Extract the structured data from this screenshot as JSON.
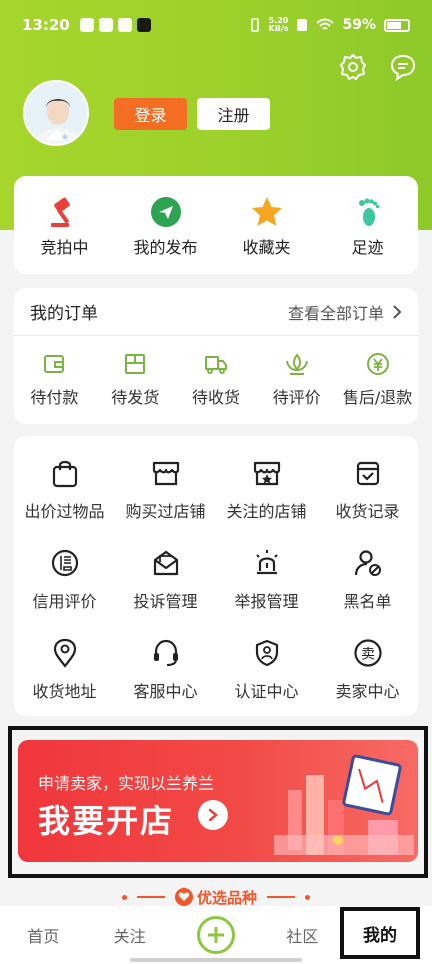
{
  "colors": {
    "top_green": "#9dd12b",
    "accent_orange": "#f36e22",
    "banner_red": "#f0363c",
    "tab_green": "#8dc63f"
  },
  "status_bar": {
    "time": "13:20",
    "net_speed_value": "5.20",
    "net_speed_unit": "KB/s",
    "battery": "59%"
  },
  "header": {
    "settings_icon": "gear-icon",
    "message_icon": "chat-bubble-icon",
    "login_label": "登录",
    "register_label": "注册"
  },
  "quick_actions": [
    {
      "label": "竞拍中",
      "icon": "auction-hammer-icon"
    },
    {
      "label": "我的发布",
      "icon": "paper-plane-icon"
    },
    {
      "label": "收藏夹",
      "icon": "star-icon"
    },
    {
      "label": "足迹",
      "icon": "footprint-icon"
    }
  ],
  "orders": {
    "title": "我的订单",
    "view_all": "查看全部订单",
    "items": [
      {
        "label": "待付款",
        "icon": "wallet-icon"
      },
      {
        "label": "待发货",
        "icon": "package-icon"
      },
      {
        "label": "待收货",
        "icon": "truck-icon"
      },
      {
        "label": "待评价",
        "icon": "lotus-icon"
      },
      {
        "label": "售后/退款",
        "icon": "refund-icon"
      }
    ]
  },
  "tools": [
    {
      "label": "出价过物品",
      "icon": "shopping-bag-icon"
    },
    {
      "label": "购买过店铺",
      "icon": "storefront-icon"
    },
    {
      "label": "关注的店铺",
      "icon": "store-star-icon"
    },
    {
      "label": "收货记录",
      "icon": "received-box-icon"
    },
    {
      "label": "信用评价",
      "icon": "credit-icon"
    },
    {
      "label": "投诉管理",
      "icon": "complaint-icon"
    },
    {
      "label": "举报管理",
      "icon": "alarm-light-icon"
    },
    {
      "label": "黑名单",
      "icon": "user-block-icon"
    },
    {
      "label": "收货地址",
      "icon": "location-pin-icon"
    },
    {
      "label": "客服中心",
      "icon": "headset-icon"
    },
    {
      "label": "认证中心",
      "icon": "shield-user-icon"
    },
    {
      "label": "卖家中心",
      "icon": "seller-icon"
    }
  ],
  "banner": {
    "subtitle": "申请卖家，实现以兰养兰",
    "title": "我要开店"
  },
  "promo": {
    "text": "优选品种"
  },
  "tabbar": {
    "home": "首页",
    "follow": "关注",
    "community": "社区",
    "mine": "我的"
  }
}
